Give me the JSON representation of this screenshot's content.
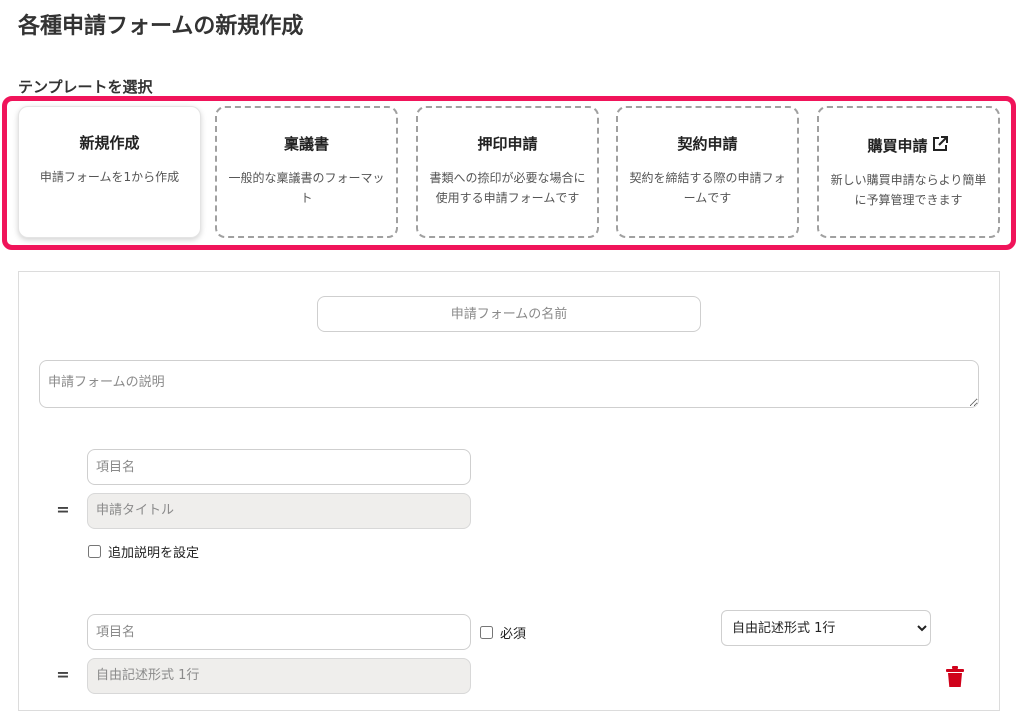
{
  "page": {
    "title": "各種申請フォームの新規作成"
  },
  "templates": {
    "section_label": "テンプレートを選択",
    "highlight_color": "#f0145a",
    "items": [
      {
        "title": "新規作成",
        "description": "申請フォームを1から作成",
        "style": "solid"
      },
      {
        "title": "稟議書",
        "description": "一般的な稟議書のフォーマット",
        "style": "dashed"
      },
      {
        "title": "押印申請",
        "description": "書類への捺印が必要な場合に使用する申請フォームです",
        "style": "dashed"
      },
      {
        "title": "契約申請",
        "description": "契約を締結する際の申請フォームです",
        "style": "dashed"
      },
      {
        "title": "購買申請",
        "description": "新しい購買申請ならより簡単に予算管理できます",
        "style": "dashed",
        "icon": "external-link-icon"
      }
    ]
  },
  "form": {
    "name_placeholder": "申請フォームの名前",
    "description_placeholder": "申請フォームの説明",
    "fields": [
      {
        "handle": "=",
        "name_placeholder": "項目名",
        "preview_text": "申請タイトル",
        "extra_description_label": "追加説明を設定"
      },
      {
        "handle": "=",
        "name_placeholder": "項目名",
        "required_label": "必須",
        "type_selected": "自由記述形式 1行",
        "preview_text": "自由記述形式 1行",
        "delete_icon": "trash-icon",
        "delete_color": "#d0021b"
      }
    ]
  }
}
